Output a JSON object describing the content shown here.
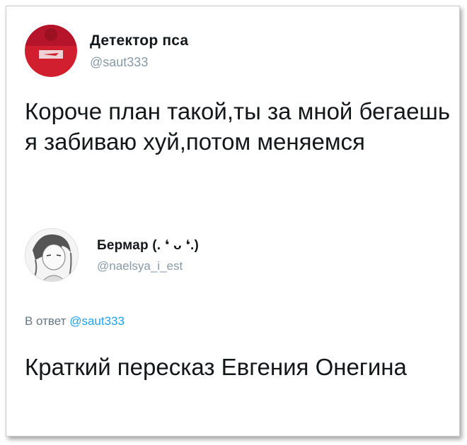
{
  "tweet": {
    "author_name": "Детектор пса",
    "author_handle": "@saut333",
    "avatar_icon": "avatar-red-shirt-icon",
    "text": "Короче план такой,ты за мной бегаешь я забиваю хуй,потом меняемся"
  },
  "reply": {
    "author_name": "Бермар (. ❛ ᴗ ❛.)",
    "author_handle": "@naelsya_i_est",
    "avatar_icon": "avatar-anime-sketch-icon",
    "reply_prefix": "В ответ",
    "reply_to_handle": "@saut333",
    "text": "Краткий пересказ Евгения Онегина"
  },
  "colors": {
    "text": "#14171a",
    "muted": "#8899a6",
    "link": "#1da1f2",
    "avatar_red": "#c8102e"
  }
}
